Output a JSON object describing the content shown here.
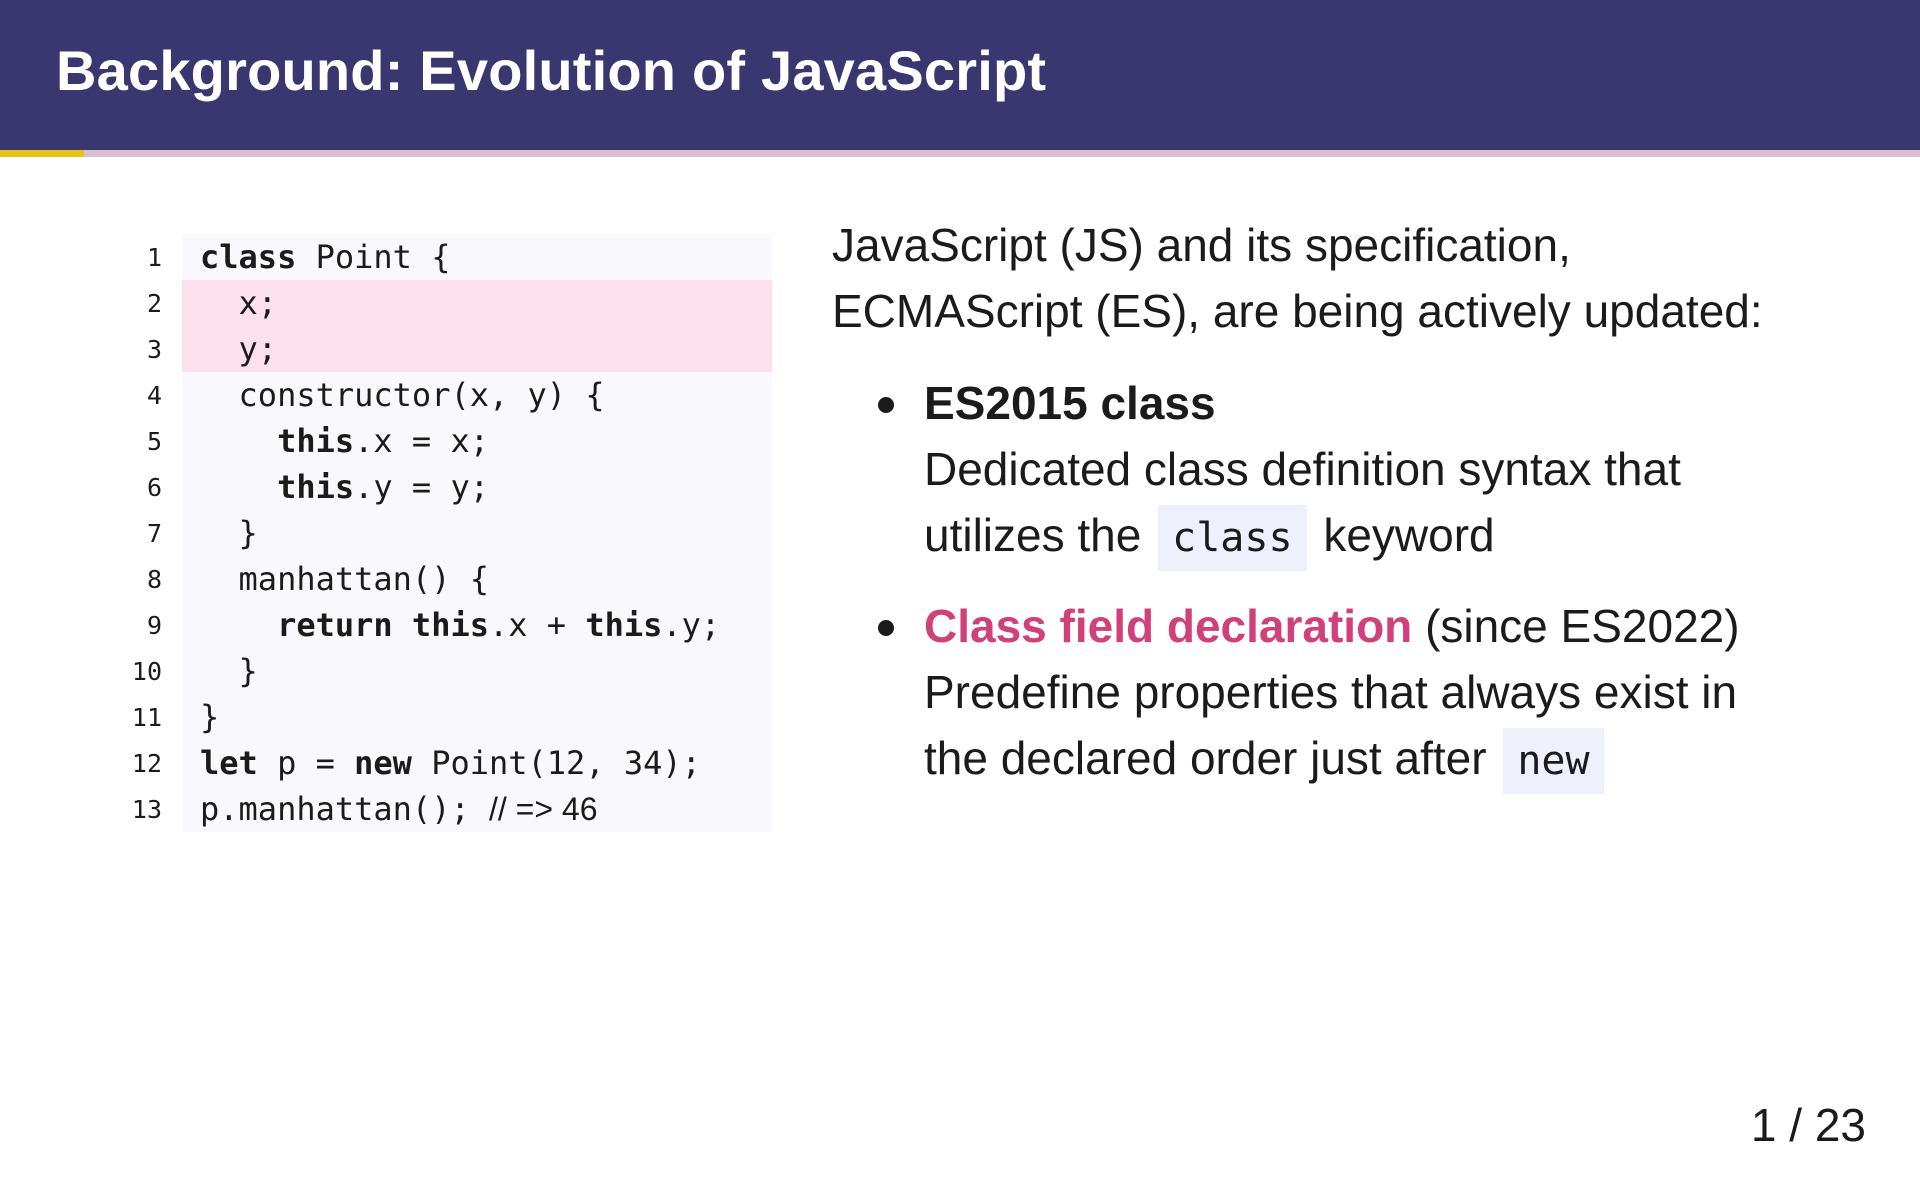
{
  "slide": {
    "title": "Background: Evolution of JavaScript",
    "page_number": "1 / 23",
    "progress_fraction": 0.043
  },
  "code": {
    "lines": [
      {
        "no": "1",
        "highlighted": false,
        "tokens": [
          {
            "t": "class",
            "kw": true
          },
          {
            "t": " Point {"
          }
        ]
      },
      {
        "no": "2",
        "highlighted": true,
        "tokens": [
          {
            "t": "  x;"
          }
        ]
      },
      {
        "no": "3",
        "highlighted": true,
        "tokens": [
          {
            "t": "  y;"
          }
        ]
      },
      {
        "no": "4",
        "highlighted": false,
        "tokens": [
          {
            "t": "  constructor(x, y) {"
          }
        ]
      },
      {
        "no": "5",
        "highlighted": false,
        "tokens": [
          {
            "t": "    "
          },
          {
            "t": "this",
            "kw": true
          },
          {
            "t": ".x = x;"
          }
        ]
      },
      {
        "no": "6",
        "highlighted": false,
        "tokens": [
          {
            "t": "    "
          },
          {
            "t": "this",
            "kw": true
          },
          {
            "t": ".y = y;"
          }
        ]
      },
      {
        "no": "7",
        "highlighted": false,
        "tokens": [
          {
            "t": "  }"
          }
        ]
      },
      {
        "no": "8",
        "highlighted": false,
        "tokens": [
          {
            "t": "  manhattan() {"
          }
        ]
      },
      {
        "no": "9",
        "highlighted": false,
        "tokens": [
          {
            "t": "    "
          },
          {
            "t": "return",
            "kw": true
          },
          {
            "t": " "
          },
          {
            "t": "this",
            "kw": true
          },
          {
            "t": ".x + "
          },
          {
            "t": "this",
            "kw": true
          },
          {
            "t": ".y;"
          }
        ]
      },
      {
        "no": "10",
        "highlighted": false,
        "tokens": [
          {
            "t": "  }"
          }
        ]
      },
      {
        "no": "11",
        "highlighted": false,
        "tokens": [
          {
            "t": "}"
          }
        ]
      },
      {
        "no": "12",
        "highlighted": false,
        "tokens": [
          {
            "t": "let",
            "kw": true
          },
          {
            "t": " p = "
          },
          {
            "t": "new",
            "kw": true
          },
          {
            "t": " Point(12, 34);"
          }
        ]
      },
      {
        "no": "13",
        "highlighted": false,
        "tokens": [
          {
            "t": "p.manhattan(); "
          },
          {
            "t": "// => 46",
            "comment": true
          }
        ]
      }
    ]
  },
  "content": {
    "intro_line1": "JavaScript (JS) and its specification,",
    "intro_line2": "ECMAScript (ES), are being actively updated:",
    "bullet1": {
      "title": "ES2015 class",
      "desc_line1": "Dedicated class definition syntax that",
      "desc_line2_before": "utilizes the",
      "desc_line2_code": "class",
      "desc_line2_after": "keyword"
    },
    "bullet2": {
      "title": "Class field declaration",
      "title_suffix": "(since ES2022)",
      "desc_line1": "Predefine properties that always exist in",
      "desc_line2_before": "the declared order just after",
      "desc_line2_code": "new"
    }
  },
  "colors": {
    "header_bg": "#3a3670",
    "progress_fill": "#e8c312",
    "progress_track": "#d9bfcf",
    "code_bg": "#f8f8fd",
    "code_highlight": "#fce1ec",
    "accent": "#d2407a",
    "inline_code_bg": "#eef0fb"
  }
}
